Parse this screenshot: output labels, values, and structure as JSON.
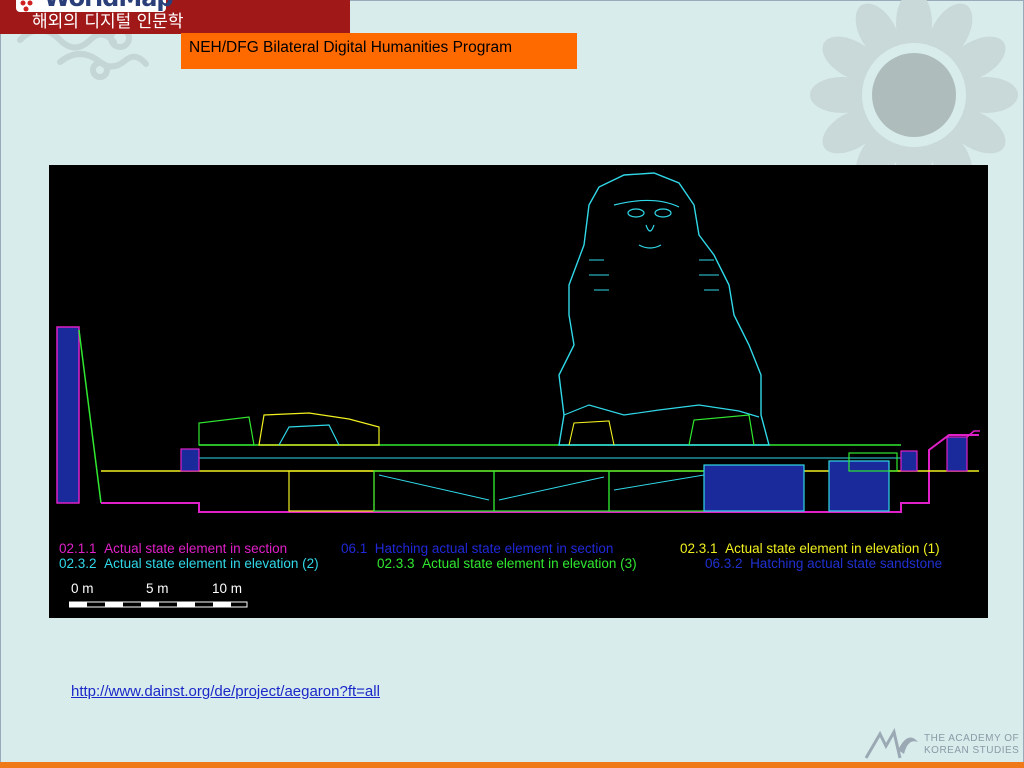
{
  "header": {
    "logo_text": "WorldMap",
    "subtitle": "해외의 디지털 인문학",
    "program": "NEH/DFG Bilateral Digital Humanities Program"
  },
  "figure": {
    "legend": [
      {
        "code": "02.1.1",
        "label": "Actual state element in section",
        "color": "#e020c8"
      },
      {
        "code": "06.1",
        "label": "Hatching actual state element in section",
        "color": "#2028d8"
      },
      {
        "code": "02.3.1",
        "label": "Actual state element in elevation (1)",
        "color": "#f0f020"
      },
      {
        "code": "02.3.2",
        "label": "Actual state element in elevation (2)",
        "color": "#30d8e8"
      },
      {
        "code": "02.3.3",
        "label": "Actual state element in elevation (3)",
        "color": "#30e830"
      },
      {
        "code": "06.3.2",
        "label": "Hatching actual state sandstone",
        "color": "#2030d0"
      }
    ],
    "scale": [
      "0 m",
      "5 m",
      "10 m"
    ]
  },
  "source_url": "http://www.dainst.org/de/project/aegaron?ft=all",
  "footer": {
    "org_line1": "THE ACADEMY OF",
    "org_line2": "KOREAN STUDIES"
  },
  "colors": {
    "banner": "#a01818",
    "program_bg": "#ff6a00",
    "slide_bg": "#d9ecec",
    "accent_line": "#f07a1a"
  }
}
